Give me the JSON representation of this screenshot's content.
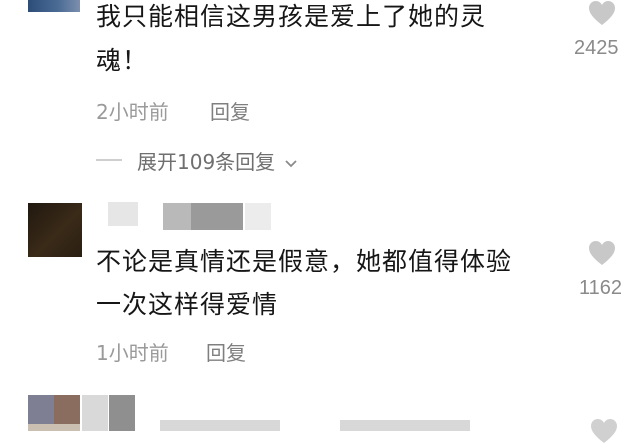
{
  "comments": [
    {
      "text_line1": "我只能相信这男孩是爱上了她的灵",
      "text_line2": "魂！",
      "time": "2小时前",
      "reply": "回复",
      "likes": "2425",
      "expand": "展开109条回复"
    },
    {
      "text_line1": "不论是真情还是假意，她都值得体验",
      "text_line2": "一次这样得爱情",
      "time": "1小时前",
      "reply": "回复",
      "likes": "1162"
    }
  ],
  "icons": {
    "like": "heart-icon",
    "expand": "chevron-down-icon"
  },
  "colors": {
    "heart": "#c8c8c8",
    "meta": "#9a9a9a"
  }
}
